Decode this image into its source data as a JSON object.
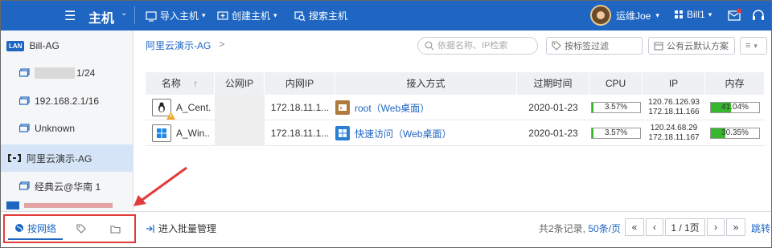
{
  "topbar": {
    "menu_icon": "hamburger-icon",
    "title": "主机",
    "import_label": "导入主机",
    "create_label": "创建主机",
    "search_label": "搜索主机",
    "user_name": "运维Joe",
    "account_name": "Bill1",
    "colors": {
      "bg": "#1e66c1"
    }
  },
  "sidebar": {
    "items": [
      {
        "label": "Bill-AG",
        "badge": "LAN"
      },
      {
        "label": "1/24"
      },
      {
        "label": "192.168.2.1/16"
      },
      {
        "label": "Unknown"
      },
      {
        "label": "阿里云演示-AG"
      },
      {
        "label": "经典云@华南 1"
      }
    ]
  },
  "main": {
    "breadcrumb": "阿里云演示-AG",
    "breadcrumb_sep": ">",
    "search_placeholder": "依据名称、IP检索",
    "tag_filter": "按标签过滤",
    "cloud_filter": "公有云默认方案",
    "columns": {
      "name": "名称",
      "public_ip": "公网IP",
      "private_ip": "内网IP",
      "access": "接入方式",
      "expire": "过期时间",
      "cpu": "CPU",
      "ip": "IP",
      "memory": "内存"
    },
    "rows": [
      {
        "name": "A_Cent.",
        "private_ip": "172.18.11.1...",
        "access": "root（Web桌面）",
        "expire": "2020-01-23",
        "cpu": "3.57%",
        "cpu_value": 3.57,
        "ip_line1": "120.76.126.93",
        "ip_line2": "172.18.11.166",
        "memory": "41.04%",
        "memory_value": 41.04
      },
      {
        "name": "A_Win..",
        "private_ip": "172.18.11.1...",
        "access": "快速访问（Web桌面）",
        "expire": "2020-01-23",
        "cpu": "3.57%",
        "cpu_value": 3.57,
        "ip_line1": "120.24.68.29",
        "ip_line2": "172.18.11.167",
        "memory": "30.35%",
        "memory_value": 30.35
      }
    ]
  },
  "footer": {
    "tab_network": "按网络",
    "batch_label": "进入批量管理",
    "records_prefix": "共2条记录,",
    "page_size": "50条/页",
    "page_first": "«",
    "page_prev": "‹",
    "page_current": "1 / 1页",
    "page_next": "›",
    "page_last": "»",
    "jump": "跳转"
  }
}
